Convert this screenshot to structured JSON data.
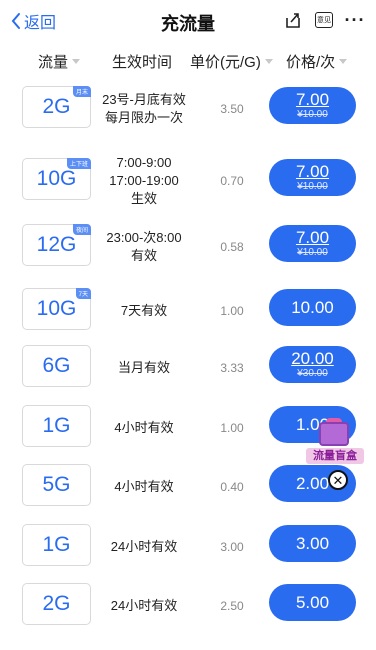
{
  "nav": {
    "back_label": "返回",
    "title": "充流量",
    "feedback_icon_label": "意见"
  },
  "columns": {
    "data": "流量",
    "validity": "生效时间",
    "unit_price": "单价(元/G)",
    "price": "价格/次"
  },
  "rows": [
    {
      "amount": "2G",
      "tag": "月末",
      "validity": [
        "23号-月底有效",
        "每月限办一次"
      ],
      "unit_price": "3.50",
      "price": "7.00",
      "original_price": "¥10.00"
    },
    {
      "amount": "10G",
      "tag": "上下班",
      "validity": [
        "7:00-9:00",
        "17:00-19:00",
        "生效"
      ],
      "unit_price": "0.70",
      "price": "7.00",
      "original_price": "¥10.00"
    },
    {
      "amount": "12G",
      "tag": "夜间",
      "validity": [
        "23:00-次8:00",
        "有效"
      ],
      "unit_price": "0.58",
      "price": "7.00",
      "original_price": "¥10.00"
    },
    {
      "amount": "10G",
      "tag": "7天",
      "validity": [
        "7天有效"
      ],
      "unit_price": "1.00",
      "price": "10.00",
      "original_price": ""
    },
    {
      "amount": "6G",
      "tag": "",
      "validity": [
        "当月有效"
      ],
      "unit_price": "3.33",
      "price": "20.00",
      "original_price": "¥30.00"
    },
    {
      "amount": "1G",
      "tag": "",
      "validity": [
        "4小时有效"
      ],
      "unit_price": "1.00",
      "price": "1.00",
      "original_price": ""
    },
    {
      "amount": "5G",
      "tag": "",
      "validity": [
        "4小时有效"
      ],
      "unit_price": "0.40",
      "price": "2.00",
      "original_price": ""
    },
    {
      "amount": "1G",
      "tag": "",
      "validity": [
        "24小时有效"
      ],
      "unit_price": "3.00",
      "price": "3.00",
      "original_price": ""
    },
    {
      "amount": "2G",
      "tag": "",
      "validity": [
        "24小时有效"
      ],
      "unit_price": "2.50",
      "price": "5.00",
      "original_price": ""
    }
  ],
  "floating_badge": {
    "label": "流量盲盒"
  },
  "colors": {
    "accent": "#2a6cf0",
    "badge": "#b36ad6"
  }
}
